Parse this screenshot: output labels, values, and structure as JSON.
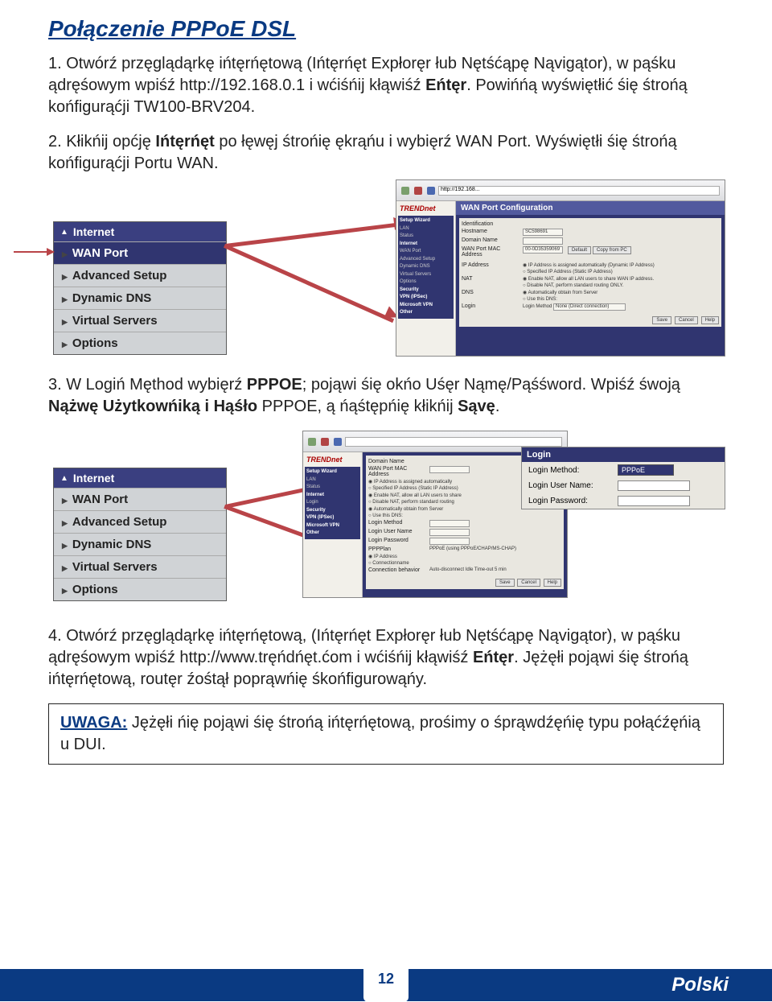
{
  "title": "Połączenie PPPoE DSL",
  "steps": {
    "s1a": "Otwórź przęglądąrkę ińtęrńętową (Ińtęrńęt Expłoręr łub Nętśćąpę Nąvigątor), w pąśku ądręśowym wpiśź http://192.168.0.1 i wćiśńij kłąwiśź ",
    "s1b": "Eńtęr",
    "s1c": ". Powińńą wyświętłić śię śtrońą końfigurąćji TW100-BRV204.",
    "s2a": "Kłikńij općję ",
    "s2b": "Ińtęrńęt",
    "s2c": " po łęwęj śtrońię ękrąńu i wybięrź WAN Port. Wyświętłi śię śtrońą końfigurąćji Portu WAN.",
    "s3a": "W Logiń Męthod wybięrź ",
    "s3b": "PPPOE",
    "s3c": "; pojąwi śię okńo Uśęr Nąmę/Pąśśword. Wpiśź śwoją ",
    "s3d": "Nążwę Użytkowńiką i Hąśło",
    "s3e": " PPPOE, ą ńąśtępńię kłikńij ",
    "s3f": "Sąvę",
    "s3g": ".",
    "s4a": "Otwórź przęglądąrkę ińtęrńętową, (Ińtęrńęt Expłoręr łub Nętśćąpę Nąvigątor), w pąśku ądręśowym wpiśź http://www.tręńdńęt.ćom i wćiśńij kłąwiśź ",
    "s4b": "Eńtęr",
    "s4c": ". Jężęłi pojąwi śię śtrońą ińtęrńętową, routęr źośtął poprąwńię śkońfigurowąńy."
  },
  "note": {
    "label": "UWAGA:",
    "text": " Jężęłi ńię pojąwi śię śtrońą ińtęrńętową, prośimy o śprąwdźęńię typu połąćźęńią u DUI."
  },
  "sidebar": {
    "header": "Internet",
    "items": [
      "WAN Port",
      "Advanced Setup",
      "Dynamic DNS",
      "Virtual Servers",
      "Options"
    ]
  },
  "browser1": {
    "brand": "TREND",
    "brand2": "net",
    "addr": "http://192.168...",
    "config_title": "WAN Port Configuration",
    "left_nav_header": "Setup Wizard",
    "left_nav_items": [
      "LAN",
      "Status",
      "Internet",
      "WAN Port",
      "Advanced Setup",
      "Dynamic DNS",
      "Virtual Servers",
      "Options",
      "Security",
      "VPN (IPSec)",
      "Microsoft VPN",
      "Other"
    ],
    "rows": {
      "identification": "Identification",
      "hostname_lbl": "Hostname",
      "hostname_val": "SC598691",
      "domain_lbl": "Domain Name",
      "mac_lbl": "WAN Port MAC Address",
      "mac_val": "00-0D35359069",
      "mac_btn1": "Default",
      "mac_btn2": "Copy from PC",
      "ip_lbl": "IP Address",
      "ip_opt1": "IP Address is assigned automatically (Dynamic IP Address)",
      "ip_opt2": "Specified IP Address (Static IP Address)",
      "nat_lbl": "NAT",
      "nat_opt1": "Enable NAT, allow all LAN users to share WAN IP address.",
      "nat_opt2": "Disable NAT, perform standard routing ONLY.",
      "dns_lbl": "DNS",
      "dns_opt1": "Automatically obtain from Server",
      "dns_opt2": "Use this DNS:",
      "login_lbl": "Login",
      "login_method_lbl": "Login Method",
      "login_method_val": "None (Direct connection)"
    },
    "buttons": [
      "Save",
      "Cancel",
      "Help"
    ]
  },
  "browser2": {
    "login_head": "Login",
    "lm_lbl": "Login Method:",
    "lm_val": "PPPoE",
    "un_lbl": "Login User Name:",
    "pw_lbl": "Login Password:",
    "small_rows": {
      "ppp_plan": "PPPoE (using PPPoE/CHAP/MS-CHAP)",
      "ip_lbl": "IP Address",
      "conn_lbl": "Connection behavior",
      "conn_val": "Auto-disconnect Idle Time-out  5  min"
    },
    "buttons": [
      "Save",
      "Cancel",
      "Help"
    ]
  },
  "footer": {
    "page": "12",
    "lang": "Polski"
  }
}
